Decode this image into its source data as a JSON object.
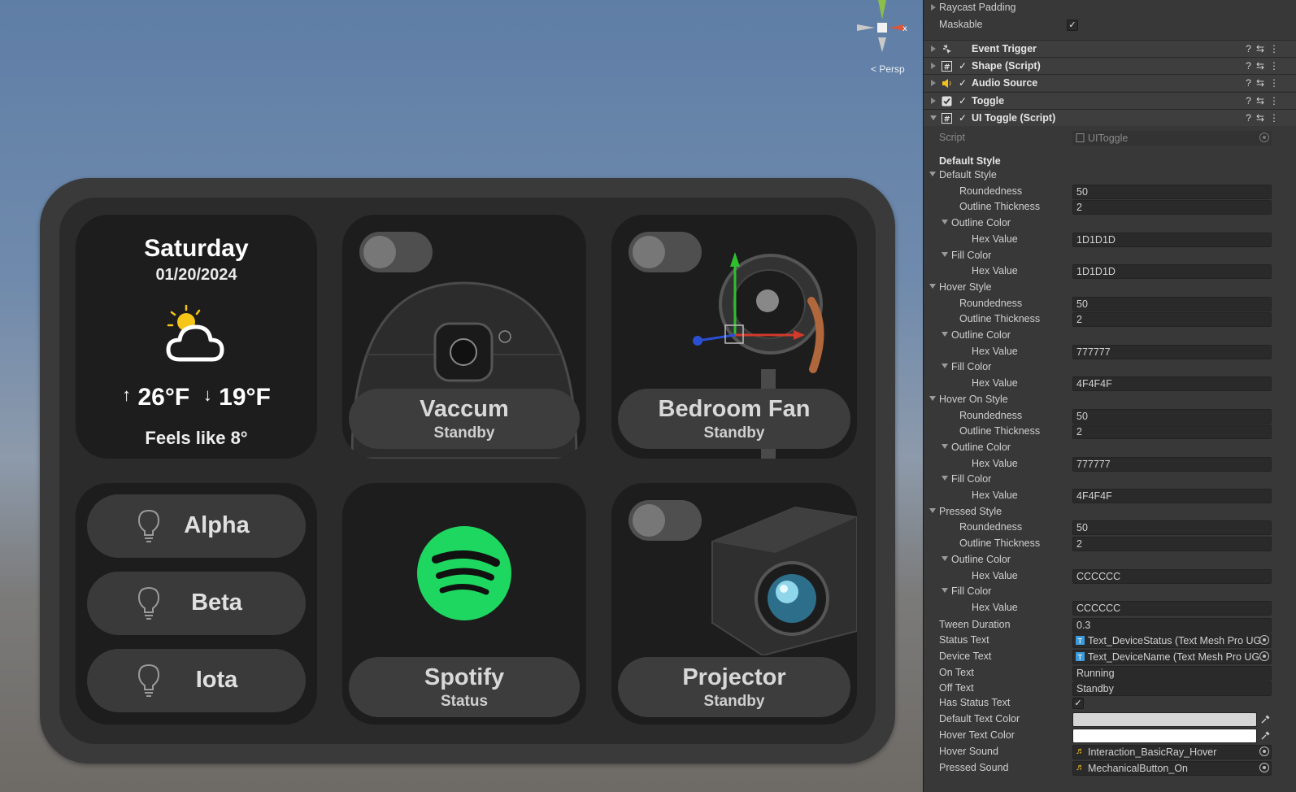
{
  "scene": {
    "persp_label": "Persp",
    "gizmo_axis": "x",
    "weather": {
      "day": "Saturday",
      "date": "01/20/2024",
      "high": "26°F",
      "low": "19°F",
      "feels_like": "Feels like 8°",
      "icon": "partly-cloudy-icon"
    },
    "devices": [
      {
        "name": "Vaccum",
        "status": "Standby"
      },
      {
        "name": "Bedroom Fan",
        "status": "Standby"
      },
      {
        "name": "Spotify",
        "status": "Status"
      },
      {
        "name": "Projector",
        "status": "Standby"
      }
    ],
    "lights": [
      {
        "name": "Alpha"
      },
      {
        "name": "Beta"
      },
      {
        "name": "Iota"
      }
    ],
    "colors": {
      "spotify_green": "#1ed760",
      "card_bg": "#1d1d1d",
      "pill_bg": "#3d3d3d"
    }
  },
  "inspector": {
    "raycast_padding": "Raycast Padding",
    "maskable": "Maskable",
    "components": [
      {
        "name": "Event Trigger",
        "icon": "event-trigger-icon"
      },
      {
        "name": "Shape (Script)",
        "icon": "script-icon"
      },
      {
        "name": "Audio Source",
        "icon": "audio-source-icon"
      },
      {
        "name": "Toggle",
        "icon": "toggle-icon"
      },
      {
        "name": "UI Toggle (Script)",
        "icon": "script-icon"
      }
    ],
    "script_label": "Script",
    "script_value": "UIToggle",
    "header_default_style": "Default Style",
    "groups": [
      {
        "title": "Default Style",
        "roundedness": "50",
        "outline_thickness": "2",
        "outline_hex": "1D1D1D",
        "fill_hex": "1D1D1D"
      },
      {
        "title": "Hover Style",
        "roundedness": "50",
        "outline_thickness": "2",
        "outline_hex": "777777",
        "fill_hex": "4F4F4F"
      },
      {
        "title": "Hover On Style",
        "roundedness": "50",
        "outline_thickness": "2",
        "outline_hex": "777777",
        "fill_hex": "4F4F4F"
      },
      {
        "title": "Pressed Style",
        "roundedness": "50",
        "outline_thickness": "2",
        "outline_hex": "CCCCCC",
        "fill_hex": "CCCCCC"
      }
    ],
    "labels": {
      "roundedness": "Roundedness",
      "outline_thickness": "Outline Thickness",
      "outline_color": "Outline Color",
      "fill_color": "Fill Color",
      "hex_value": "Hex Value"
    },
    "tween_duration_label": "Tween Duration",
    "tween_duration": "0.3",
    "status_text_label": "Status Text",
    "status_text": "Text_DeviceStatus (Text Mesh Pro UG",
    "device_text_label": "Device Text",
    "device_text": "Text_DeviceName (Text Mesh Pro UG",
    "on_text_label": "On Text",
    "on_text": "Running",
    "off_text_label": "Off Text",
    "off_text": "Standby",
    "has_status_text_label": "Has Status Text",
    "default_text_color_label": "Default Text Color",
    "default_text_color": "#d6d6d6",
    "hover_text_color_label": "Hover Text Color",
    "hover_text_color": "#ffffff",
    "hover_sound_label": "Hover Sound",
    "hover_sound": "Interaction_BasicRay_Hover",
    "pressed_sound_label": "Pressed Sound",
    "pressed_sound": "MechanicalButton_On"
  }
}
